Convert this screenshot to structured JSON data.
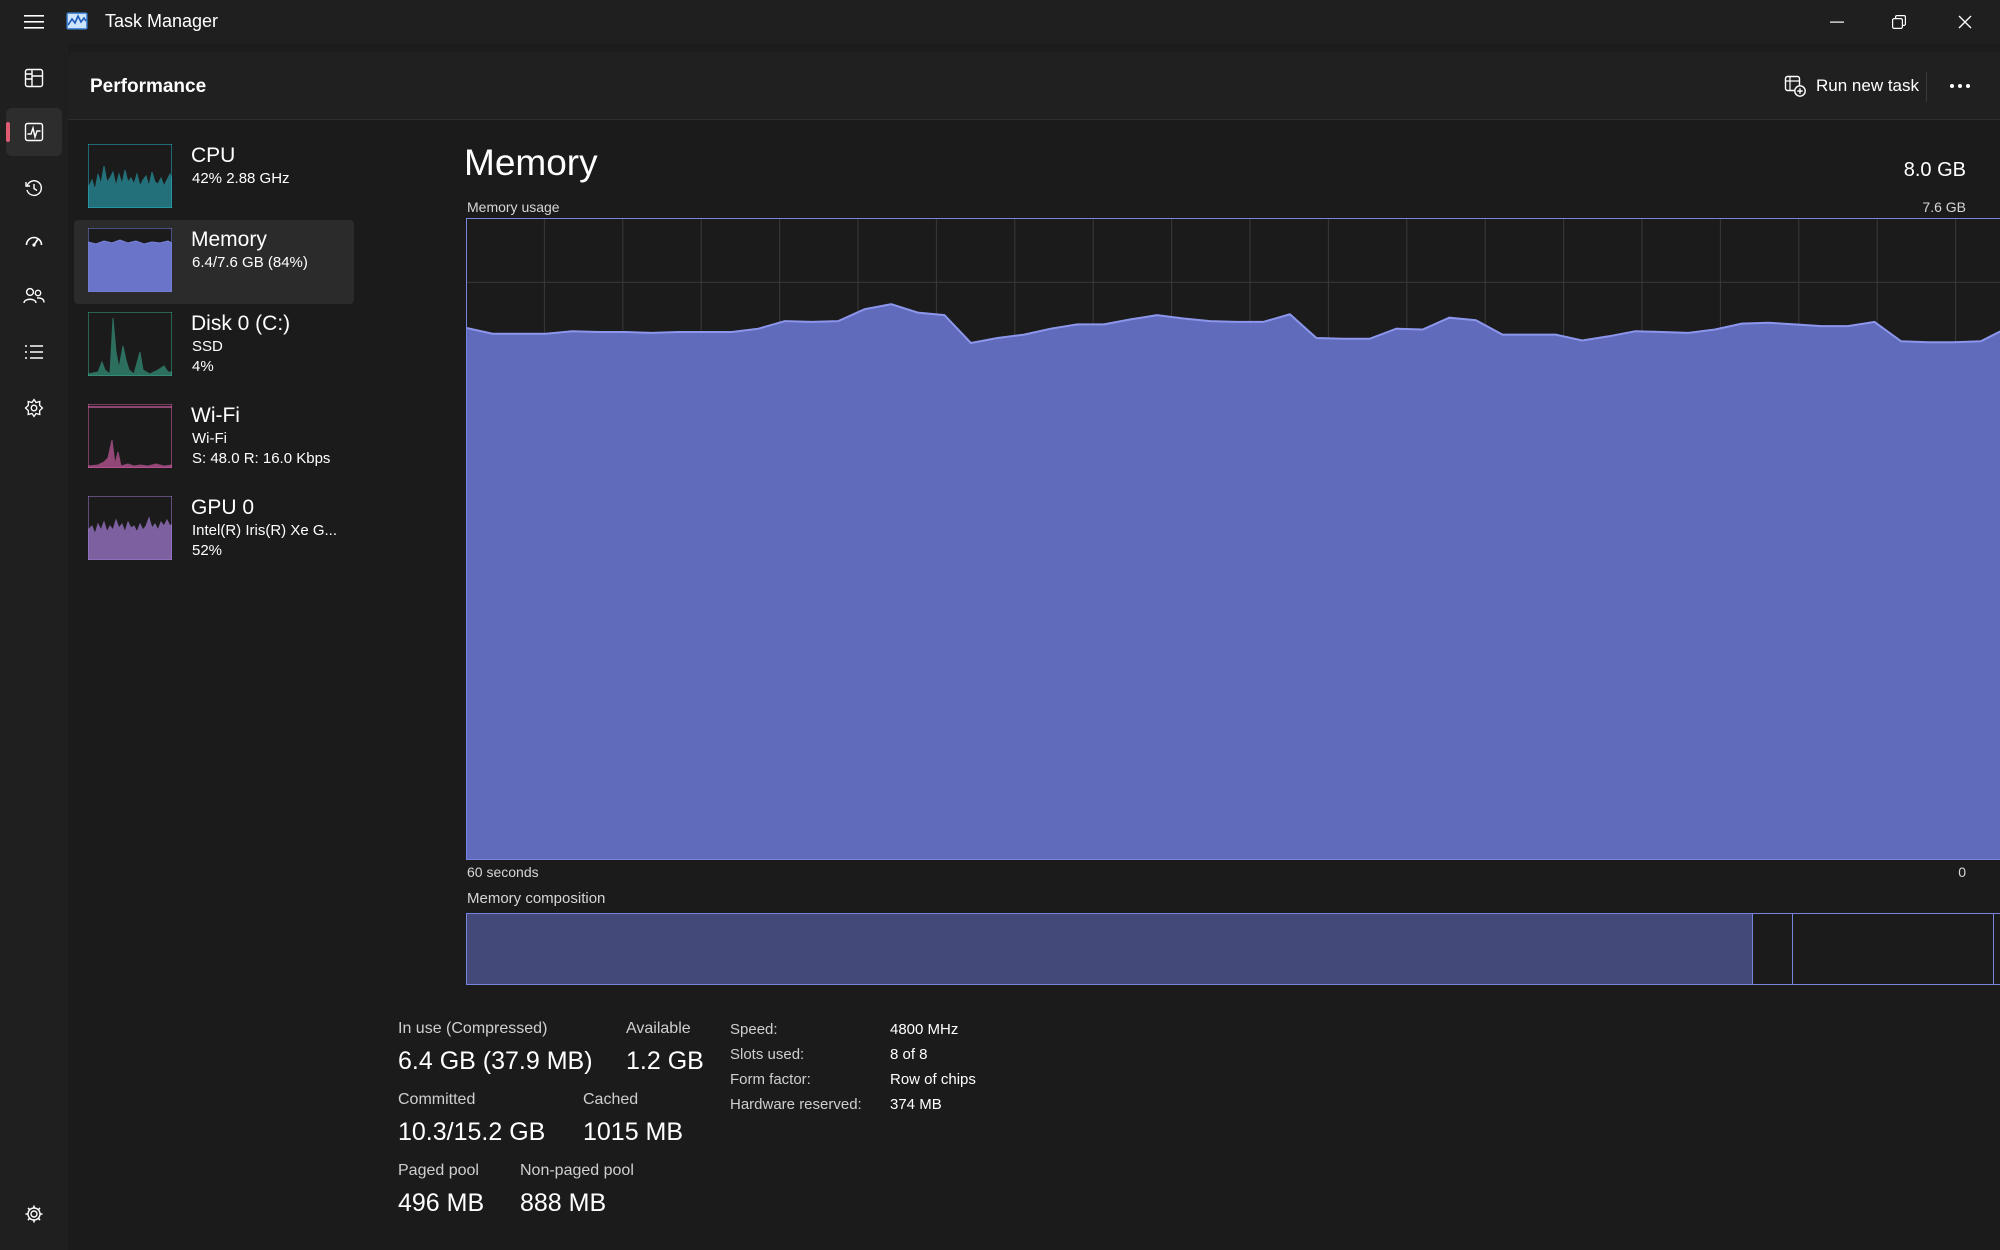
{
  "app": {
    "title": "Task Manager"
  },
  "header": {
    "title": "Performance",
    "run_task_label": "Run new task"
  },
  "nav": {
    "items": [
      {
        "name": "processes",
        "icon": "processes-icon"
      },
      {
        "name": "performance",
        "icon": "performance-icon",
        "active": true
      },
      {
        "name": "app-history",
        "icon": "history-icon"
      },
      {
        "name": "startup-apps",
        "icon": "startup-icon"
      },
      {
        "name": "users",
        "icon": "users-icon"
      },
      {
        "name": "details",
        "icon": "details-icon"
      },
      {
        "name": "services",
        "icon": "services-icon"
      }
    ]
  },
  "devices": [
    {
      "name": "CPU",
      "lines": [
        "42% 2.88 GHz"
      ],
      "color": "#2ab6c8"
    },
    {
      "name": "Memory",
      "lines": [
        "6.4/7.6 GB (84%)"
      ],
      "color": "#7884e0",
      "selected": true
    },
    {
      "name": "Disk 0 (C:)",
      "lines": [
        "SSD",
        "4%"
      ],
      "color": "#3aa88c"
    },
    {
      "name": "Wi-Fi",
      "lines": [
        "Wi-Fi",
        "S: 48.0  R: 16.0 Kbps"
      ],
      "color": "#d45fa8"
    },
    {
      "name": "GPU 0",
      "lines": [
        "Intel(R) Iris(R) Xe G...",
        "52%"
      ],
      "color": "#a67ed8"
    }
  ],
  "detail": {
    "title": "Memory",
    "total": "8.0 GB",
    "usage_label": "Memory usage",
    "usage_max": "7.6 GB",
    "axis_left": "60 seconds",
    "axis_right": "0",
    "composition_label": "Memory composition",
    "stats": {
      "in_use_label": "In use (Compressed)",
      "in_use_value": "6.4 GB (37.9 MB)",
      "available_label": "Available",
      "available_value": "1.2 GB",
      "committed_label": "Committed",
      "committed_value": "10.3/15.2 GB",
      "cached_label": "Cached",
      "cached_value": "1015 MB",
      "paged_label": "Paged pool",
      "paged_value": "496 MB",
      "nonpaged_label": "Non-paged pool",
      "nonpaged_value": "888 MB"
    },
    "info": [
      {
        "key": "Speed:",
        "value": "4800 MHz"
      },
      {
        "key": "Slots used:",
        "value": "8 of 8"
      },
      {
        "key": "Form factor:",
        "value": "Row of chips"
      },
      {
        "key": "Hardware reserved:",
        "value": "374 MB"
      }
    ]
  },
  "chart_data": {
    "type": "area",
    "title": "Memory usage",
    "xlabel": "",
    "ylabel": "",
    "x_range_seconds": [
      60,
      0
    ],
    "ylim": [
      0,
      7.6
    ],
    "series": [
      {
        "values": [
          6.3,
          6.23,
          6.23,
          6.23,
          6.26,
          6.25,
          6.25,
          6.24,
          6.25,
          6.25,
          6.25,
          6.29,
          6.38,
          6.37,
          6.38,
          6.52,
          6.58,
          6.48,
          6.45,
          6.12,
          6.18,
          6.22,
          6.29,
          6.34,
          6.34,
          6.4,
          6.45,
          6.41,
          6.38,
          6.37,
          6.37,
          6.46,
          6.18,
          6.17,
          6.17,
          6.29,
          6.28,
          6.42,
          6.39,
          6.22,
          6.22,
          6.22,
          6.15,
          6.2,
          6.26,
          6.25,
          6.24,
          6.28,
          6.35,
          6.36,
          6.34,
          6.32,
          6.32,
          6.37,
          6.14,
          6.13,
          6.13,
          6.14,
          6.3,
          6.27
        ]
      }
    ],
    "composition": {
      "in_use_gb": 6.4,
      "modified_gb": 0.2,
      "standby_gb": 1.0,
      "free_gb": 0.2
    },
    "grid": true
  }
}
